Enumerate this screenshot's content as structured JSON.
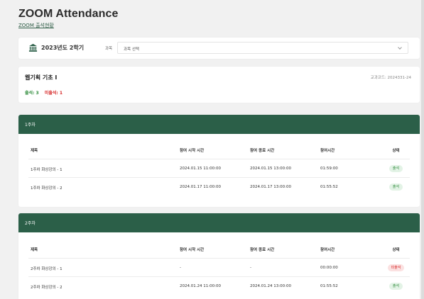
{
  "app": {
    "title": "ZOOM Attendance",
    "subtitle": "ZOOM 출석현황"
  },
  "semester": {
    "label": "2023년도 2학기",
    "subject_label": "과목",
    "subject_select": "과목 선택"
  },
  "course": {
    "name": "웹기획 기초 I",
    "code": "교과코드: 2024331-24",
    "present": "출석: 3",
    "absent": "미출석: 1"
  },
  "columns": {
    "title": "제목",
    "start": "참여 시작 시간",
    "end": "참여 종료 시간",
    "duration": "참여시간",
    "status": "상태"
  },
  "weeks": [
    {
      "label": "1주차",
      "rows": [
        {
          "title": "1주차 화상강의 - 1",
          "start": "2024.01.15 11:00:00",
          "end": "2024.01.15 13:00:00",
          "duration": "01:59:00",
          "status": "출석"
        },
        {
          "title": "1주차 화상강의 - 2",
          "start": "2024.01.17 11:00:00",
          "end": "2024.01.17 13:00:00",
          "duration": "01:55:52",
          "status": "출석"
        }
      ]
    },
    {
      "label": "2주차",
      "rows": [
        {
          "title": "2주차 화상강의 - 1",
          "start": "-",
          "end": "-",
          "duration": "00:00:00",
          "status": "미출석"
        },
        {
          "title": "2주차 화상강의 - 2",
          "start": "2024.01.24 11:00:00",
          "end": "2024.01.24 13:00:00",
          "duration": "01:55:52",
          "status": "출석"
        }
      ]
    }
  ],
  "colors": {
    "accent": "#2b5f48",
    "present": "#2e8b3a",
    "absent": "#d62828"
  }
}
